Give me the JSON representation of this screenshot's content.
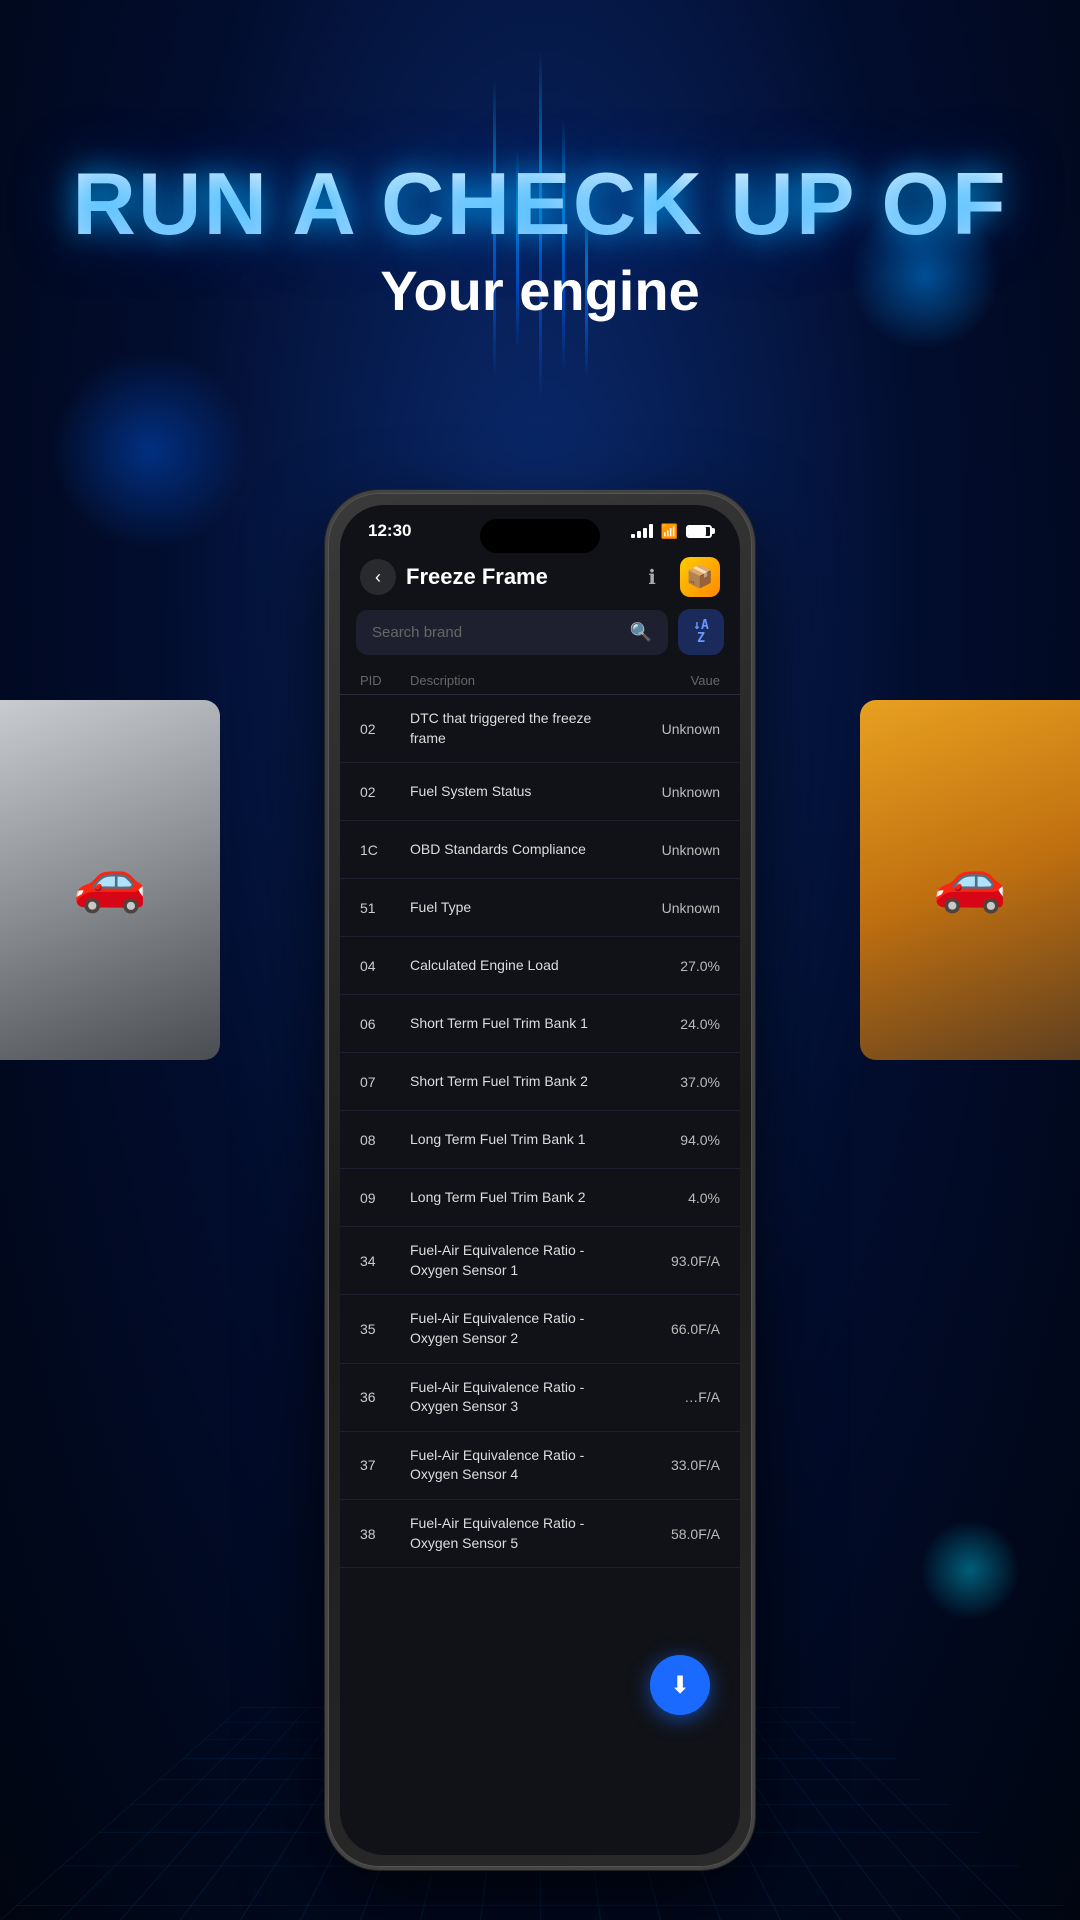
{
  "background": {
    "colors": {
      "primary": "#000918",
      "glow": "#0a2a6e"
    }
  },
  "hero": {
    "title": "RUN A CHECK UP OF",
    "subtitle": "Your engine"
  },
  "status_bar": {
    "time": "12:30",
    "signal": "4 bars",
    "wifi": true,
    "battery": "80%"
  },
  "app": {
    "title": "Freeze Frame",
    "back_label": "‹",
    "info_icon": "ℹ",
    "box_icon": "📦"
  },
  "search": {
    "placeholder": "Search brand",
    "search_icon": "🔍",
    "sort_icon": "A↓Z"
  },
  "table": {
    "columns": [
      "PID",
      "Description",
      "Vaue"
    ],
    "rows": [
      {
        "pid": "02",
        "description": "DTC that triggered the freeze frame",
        "value": "Unknown"
      },
      {
        "pid": "02",
        "description": "Fuel System Status",
        "value": "Unknown"
      },
      {
        "pid": "1C",
        "description": "OBD Standards Compliance",
        "value": "Unknown"
      },
      {
        "pid": "51",
        "description": "Fuel Type",
        "value": "Unknown"
      },
      {
        "pid": "04",
        "description": "Calculated Engine Load",
        "value": "27.0%"
      },
      {
        "pid": "06",
        "description": "Short Term Fuel Trim Bank 1",
        "value": "24.0%"
      },
      {
        "pid": "07",
        "description": "Short Term Fuel Trim Bank 2",
        "value": "37.0%"
      },
      {
        "pid": "08",
        "description": "Long Term Fuel Trim Bank 1",
        "value": "94.0%"
      },
      {
        "pid": "09",
        "description": "Long Term Fuel Trim Bank 2",
        "value": "4.0%"
      },
      {
        "pid": "34",
        "description": "Fuel-Air Equivalence Ratio - Oxygen Sensor 1",
        "value": "93.0F/A"
      },
      {
        "pid": "35",
        "description": "Fuel-Air Equivalence Ratio - Oxygen Sensor 2",
        "value": "66.0F/A"
      },
      {
        "pid": "36",
        "description": "Fuel-Air Equivalence Ratio - Oxygen Sensor 3",
        "value": "…F/A"
      },
      {
        "pid": "37",
        "description": "Fuel-Air Equivalence Ratio - Oxygen Sensor 4",
        "value": "33.0F/A"
      },
      {
        "pid": "38",
        "description": "Fuel-Air Equivalence Ratio - Oxygen Sensor 5",
        "value": "58.0F/A"
      }
    ]
  },
  "fab": {
    "icon": "⬇",
    "label": "Download"
  }
}
